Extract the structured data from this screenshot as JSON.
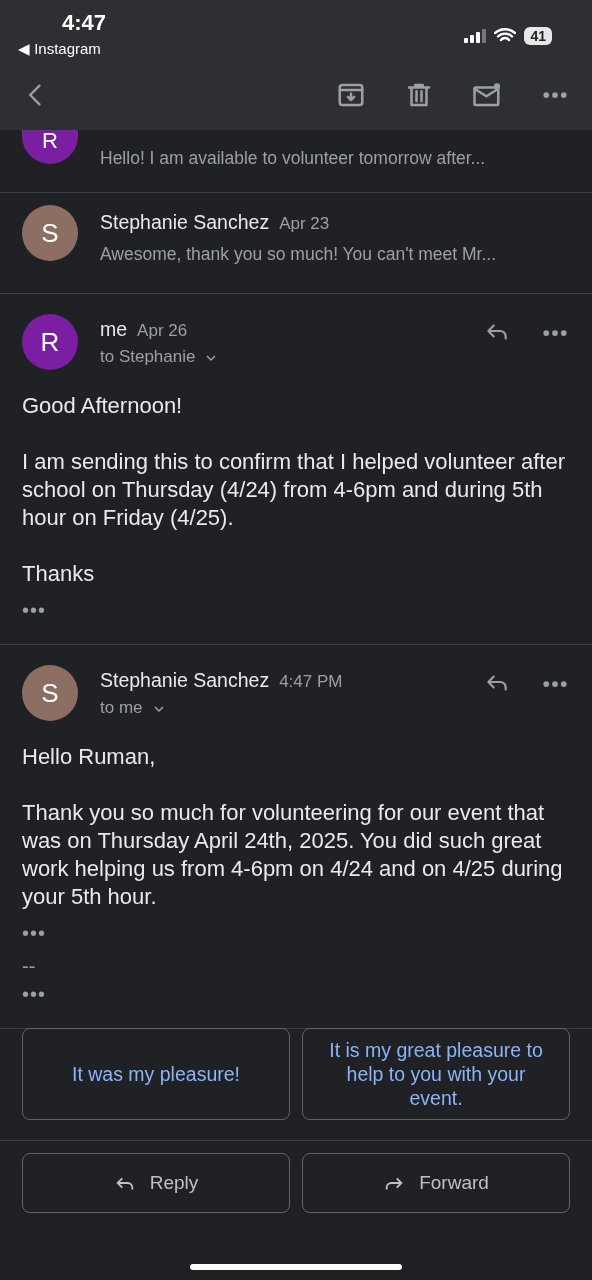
{
  "status_bar": {
    "time": "4:47",
    "back_app": "◀ Instagram",
    "battery": "41"
  },
  "collapsed": [
    {
      "avatar": "R",
      "color": "#7b1fa2",
      "snippet": "Hello! I am available to volunteer tomorrow after..."
    },
    {
      "avatar": "S",
      "color": "#8d6e63",
      "sender": "Stephanie Sanchez",
      "date": "Apr 23",
      "snippet": "Awesome, thank you so much! You can't meet Mr..."
    }
  ],
  "messages": [
    {
      "avatar": "R",
      "color": "#7b1fa2",
      "sender": "me",
      "date": "Apr 26",
      "recipient": "to Stephanie",
      "paragraphs": [
        "Good Afternoon!",
        "I am sending this to confirm that I helped volunteer after school on Thursday (4/24) from 4-6pm and during 5th hour on Friday (4/25).",
        "Thanks"
      ],
      "trimmed": "•••"
    },
    {
      "avatar": "S",
      "color": "#8d6e63",
      "sender": "Stephanie Sanchez",
      "date": "4:47 PM",
      "recipient": "to me",
      "paragraphs": [
        "Hello Ruman,",
        "Thank you so much for volunteering for our event that was on Thursday April 24th, 2025. You did such great work helping us from 4-6pm on 4/24 and on 4/25 during your 5th hour."
      ],
      "trimmed": "•••",
      "signature": {
        "text": "--",
        "trimmed": "•••"
      }
    }
  ],
  "smart_replies": [
    "It was my pleasure!",
    "It is my great pleasure to help to you with your event."
  ],
  "actions": [
    {
      "kind": "reply",
      "label": "Reply"
    },
    {
      "kind": "forward",
      "label": "Forward"
    }
  ]
}
